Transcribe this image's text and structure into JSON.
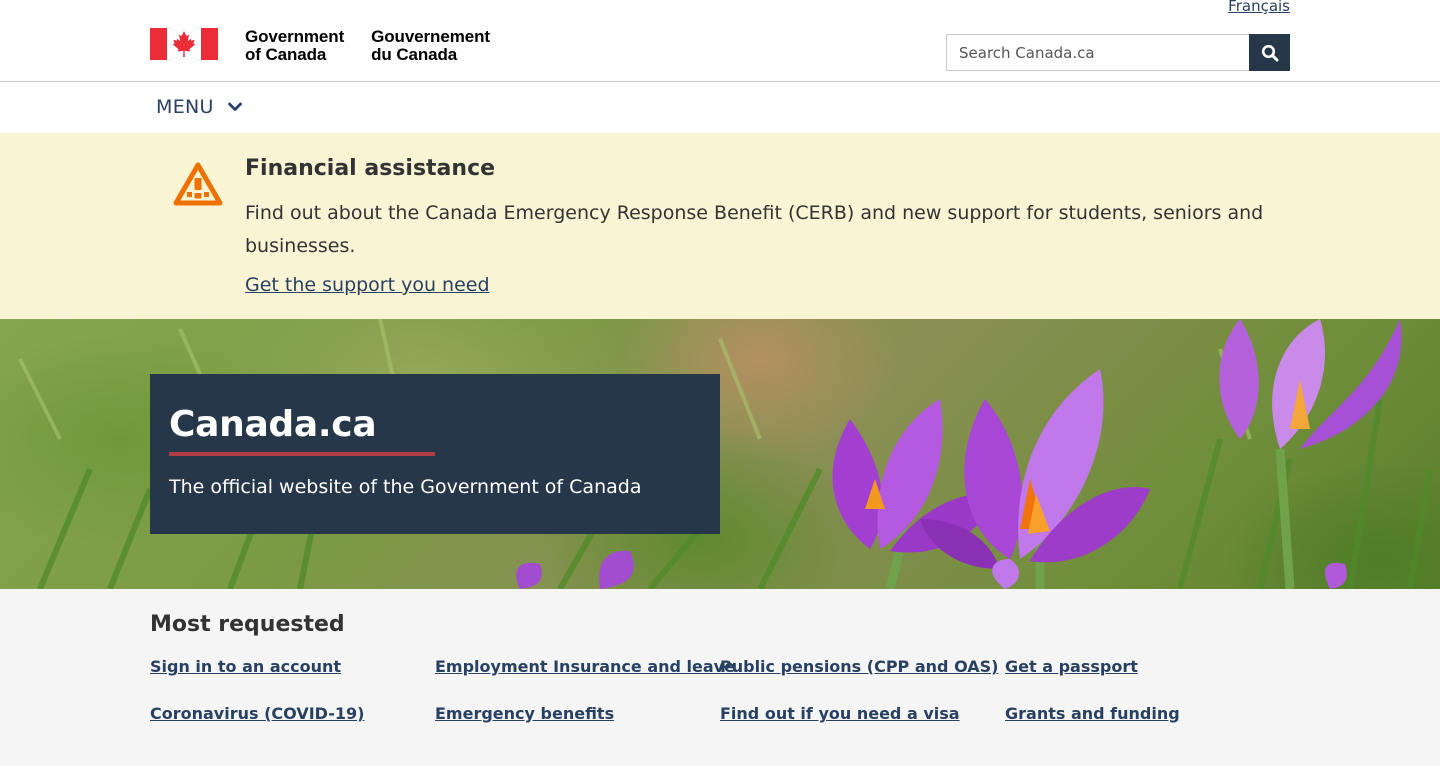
{
  "header": {
    "language_link": "Français",
    "wordmark_en": [
      "Government",
      "of Canada"
    ],
    "wordmark_fr": [
      "Gouvernement",
      "du Canada"
    ],
    "search": {
      "placeholder": "Search Canada.ca"
    },
    "menu_label": "MENU"
  },
  "alert": {
    "title": "Financial assistance",
    "text": "Find out about the Canada Emergency Response Benefit (CERB) and new support for students, seniors and businesses.",
    "link": "Get the support you need",
    "icon_color": "#ee7100"
  },
  "hero": {
    "title": "Canada.ca",
    "subtitle": "The official website of the Government of Canada",
    "accent_color": "#af3c43"
  },
  "most_requested": {
    "title": "Most requested",
    "links": [
      [
        "Sign in to an account",
        "Employment Insurance and leave",
        "Public pensions (CPP and OAS)",
        "Get a passport"
      ],
      [
        "Coronavirus (COVID-19)",
        "Emergency benefits",
        "Find out if you need a visa",
        "Grants and funding"
      ]
    ]
  },
  "colors": {
    "brand_dark": "#26374a",
    "link": "#284162",
    "alert_bg": "#f9f4d4",
    "flag_red": "#eb2d37"
  }
}
